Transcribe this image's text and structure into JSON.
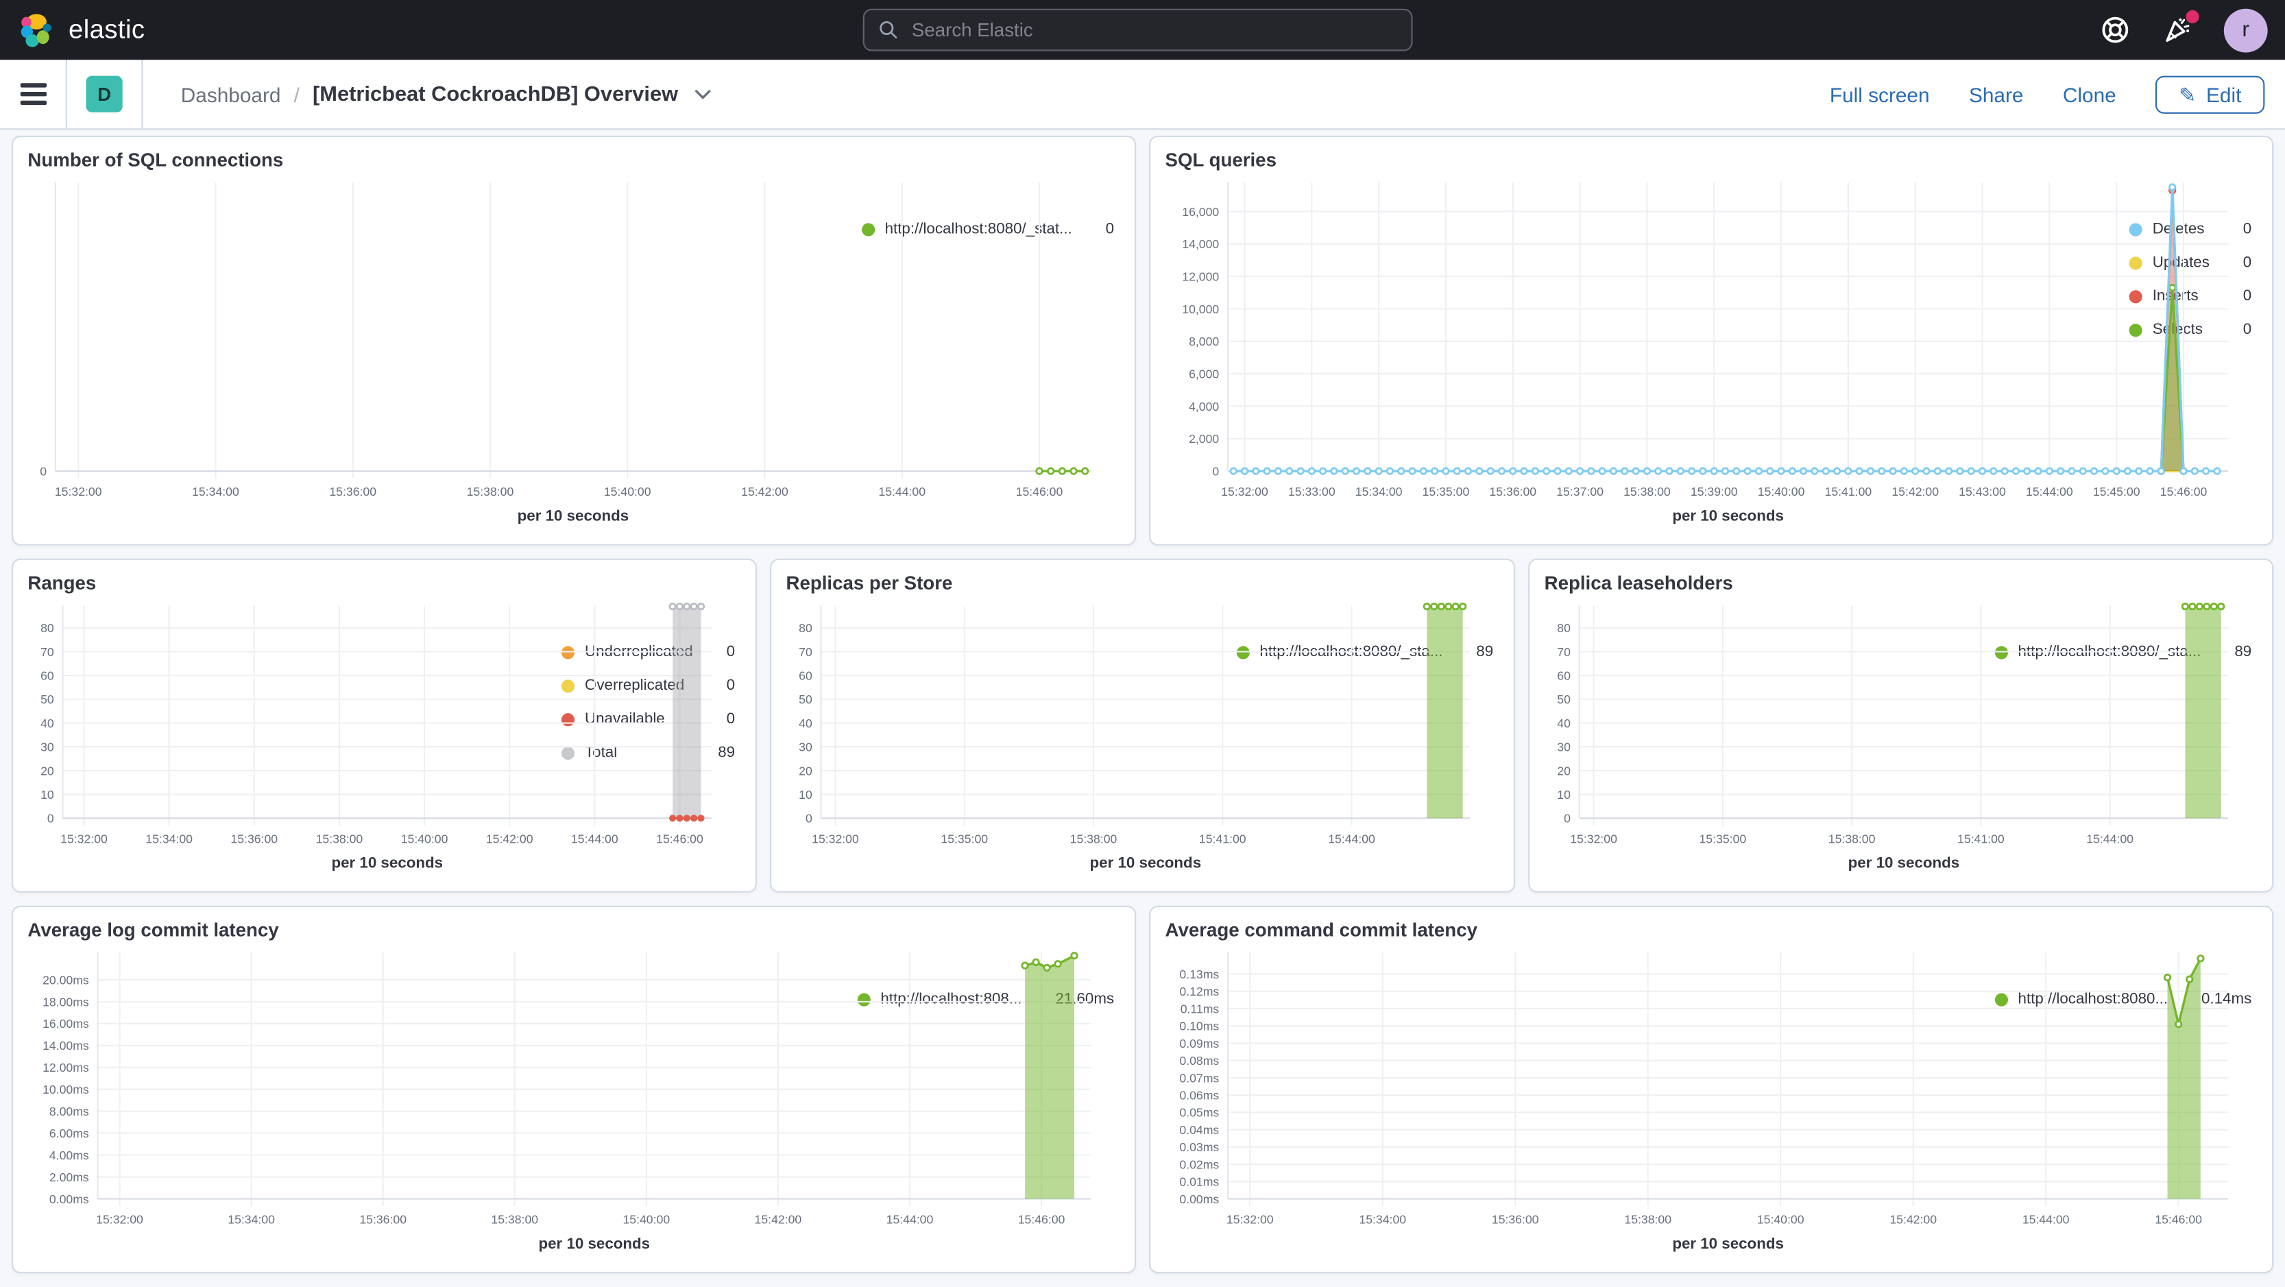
{
  "header": {
    "brand": "elastic",
    "search_placeholder": "Search Elastic",
    "avatar_initial": "r",
    "icons": [
      "help-icon",
      "news-icon",
      "avatar"
    ]
  },
  "toolbar": {
    "app_badge": "D",
    "breadcrumb_root": "Dashboard",
    "breadcrumb_sep": "/",
    "title": "[Metricbeat CockroachDB] Overview",
    "actions": {
      "full_screen": "Full screen",
      "share": "Share",
      "clone": "Clone",
      "edit": "Edit"
    }
  },
  "colors": {
    "topnav_bg": "#1d1e24",
    "accent_blue": "#2a6cb3",
    "badge_teal": "#3ebeb0",
    "notification_pink": "#dd2d66",
    "series_green": "#74b62b",
    "series_blue": "#7ecbf2",
    "series_yellow": "#efd24a",
    "series_red": "#e05c4f",
    "series_orange": "#f0a03a",
    "series_gray": "#9a9ba1",
    "grid_line": "#eef0f3",
    "axis_text": "#69707d"
  },
  "panels": [
    {
      "id": "sql-connections",
      "title": "Number of SQL connections",
      "legend": [
        {
          "label": "http://localhost:8080/_stat...",
          "value": "0",
          "color": "#74b62b"
        }
      ],
      "chart_data": {
        "type": "line",
        "xlabel": "per 10 seconds",
        "x_domain": [
          "15:31:40",
          "15:46:45"
        ],
        "x_ticks": [
          "15:32:00",
          "15:34:00",
          "15:36:00",
          "15:38:00",
          "15:40:00",
          "15:42:00",
          "15:44:00",
          "15:46:00"
        ],
        "y_tick_values": [
          0
        ],
        "y_tick_labels": [
          "0"
        ],
        "ylim": [
          0,
          8
        ],
        "series": [
          {
            "name": "http://localhost:8080/_stat...",
            "color": "#74b62b",
            "type": "line",
            "marker": "hollow",
            "data": [
              {
                "span": [
                  "15:46:00",
                  "15:46:40",
                  10,
                  0
                ]
              }
            ]
          }
        ]
      }
    },
    {
      "id": "sql-queries",
      "title": "SQL queries",
      "legend": [
        {
          "label": "Deletes",
          "value": "0",
          "color": "#7ecbf2"
        },
        {
          "label": "Updates",
          "value": "0",
          "color": "#efd24a"
        },
        {
          "label": "Inserts",
          "value": "0",
          "color": "#e05c4f"
        },
        {
          "label": "Selects",
          "value": "0",
          "color": "#74b62b"
        }
      ],
      "chart_data": {
        "type": "line",
        "xlabel": "per 10 seconds",
        "x_domain": [
          "15:31:45",
          "15:46:40"
        ],
        "x_ticks": [
          "15:32:00",
          "15:33:00",
          "15:34:00",
          "15:35:00",
          "15:36:00",
          "15:37:00",
          "15:38:00",
          "15:39:00",
          "15:40:00",
          "15:41:00",
          "15:42:00",
          "15:43:00",
          "15:44:00",
          "15:45:00",
          "15:46:00"
        ],
        "y_tick_values": [
          0,
          2000,
          4000,
          6000,
          8000,
          10000,
          12000,
          14000,
          16000
        ],
        "y_tick_labels": [
          "0",
          "2,000",
          "4,000",
          "6,000",
          "8,000",
          "10,000",
          "12,000",
          "14,000",
          "16,000"
        ],
        "ylim": [
          0,
          17800
        ],
        "series": [
          {
            "name": "Updates",
            "color": "#efd24a",
            "type": "line",
            "marker": "none",
            "data": [
              {
                "t": "15:45:40",
                "v": 0
              },
              {
                "t": "15:45:50",
                "v": 0
              },
              {
                "t": "15:46:00",
                "v": 0
              }
            ]
          },
          {
            "name": "Inserts",
            "color": "#e05c4f",
            "type": "area",
            "fill_opacity": 0.45,
            "marker": "hollow",
            "data": [
              {
                "t": "15:45:40",
                "v": 0
              },
              {
                "t": "15:45:50",
                "v": 17300
              },
              {
                "t": "15:46:00",
                "v": 0
              }
            ]
          },
          {
            "name": "Selects",
            "color": "#74b62b",
            "type": "area",
            "fill_opacity": 0.5,
            "marker": "hollow",
            "data": [
              {
                "t": "15:45:40",
                "v": 0
              },
              {
                "t": "15:45:50",
                "v": 11300
              },
              {
                "t": "15:46:00",
                "v": 0
              }
            ]
          },
          {
            "name": "Deletes",
            "color": "#7ecbf2",
            "type": "line",
            "marker": "hollow",
            "data": [
              {
                "span": [
                  "15:31:50",
                  "15:45:40",
                  10,
                  0
                ]
              },
              {
                "t": "15:45:50",
                "v": 17500
              },
              {
                "span": [
                  "15:46:00",
                  "15:46:30",
                  10,
                  0
                ]
              }
            ]
          }
        ]
      }
    },
    {
      "id": "ranges",
      "title": "Ranges",
      "legend": [
        {
          "label": "Underreplicated",
          "value": "0",
          "color": "#f0a03a"
        },
        {
          "label": "Overreplicated",
          "value": "0",
          "color": "#efd24a"
        },
        {
          "label": "Unavailable",
          "value": "0",
          "color": "#e05c4f"
        },
        {
          "label": "Total",
          "value": "89",
          "color": "#c8c9cd"
        }
      ],
      "chart_data": {
        "type": "area",
        "xlabel": "per 10 seconds",
        "x_domain": [
          "15:31:30",
          "15:46:45"
        ],
        "x_ticks": [
          "15:32:00",
          "15:34:00",
          "15:36:00",
          "15:38:00",
          "15:40:00",
          "15:42:00",
          "15:44:00",
          "15:46:00"
        ],
        "y_tick_values": [
          0,
          10,
          20,
          30,
          40,
          50,
          60,
          70,
          80
        ],
        "y_tick_labels": [
          "0",
          "10",
          "20",
          "30",
          "40",
          "50",
          "60",
          "70",
          "80"
        ],
        "ylim": [
          0,
          89.5
        ],
        "series": [
          {
            "name": "Total",
            "color": "#9a9ba1",
            "type": "area",
            "fill_opacity": 0.4,
            "stroke_color": "#c4c5ca",
            "marker": "hollow",
            "marker_color": "#b9bcc3",
            "data": [
              {
                "span": [
                  "15:45:50",
                  "15:46:30",
                  10,
                  89
                ]
              }
            ]
          },
          {
            "name": "Underreplicated",
            "color": "#f0a03a",
            "type": "line",
            "marker": "none",
            "data": [
              {
                "span": [
                  "15:45:50",
                  "15:46:30",
                  10,
                  0
                ]
              }
            ]
          },
          {
            "name": "Overreplicated",
            "color": "#efd24a",
            "type": "line",
            "marker": "none",
            "data": [
              {
                "span": [
                  "15:45:50",
                  "15:46:30",
                  10,
                  0
                ]
              }
            ]
          },
          {
            "name": "Unavailable",
            "color": "#e05c4f",
            "type": "line",
            "marker": "solid",
            "data": [
              {
                "span": [
                  "15:45:50",
                  "15:46:30",
                  10,
                  0
                ]
              }
            ]
          }
        ]
      }
    },
    {
      "id": "replicas-per-store",
      "title": "Replicas per Store",
      "legend": [
        {
          "label": "http://localhost:8080/_sta...",
          "value": "89",
          "color": "#74b62b"
        }
      ],
      "chart_data": {
        "type": "area",
        "xlabel": "per 10 seconds",
        "x_domain": [
          "15:31:40",
          "15:46:45"
        ],
        "x_ticks": [
          "15:32:00",
          "15:35:00",
          "15:38:00",
          "15:41:00",
          "15:44:00"
        ],
        "y_tick_values": [
          0,
          10,
          20,
          30,
          40,
          50,
          60,
          70,
          80
        ],
        "y_tick_labels": [
          "0",
          "10",
          "20",
          "30",
          "40",
          "50",
          "60",
          "70",
          "80"
        ],
        "ylim": [
          0,
          89.5
        ],
        "series": [
          {
            "name": "http://localhost:8080/_sta...",
            "color": "#74b62b",
            "type": "area",
            "fill_opacity": 0.5,
            "marker": "hollow",
            "data": [
              {
                "span": [
                  "15:45:45",
                  "15:46:35",
                  10,
                  89
                ]
              }
            ]
          }
        ]
      }
    },
    {
      "id": "replica-leaseholders",
      "title": "Replica leaseholders",
      "legend": [
        {
          "label": "http://localhost:8080/_sta...",
          "value": "89",
          "color": "#74b62b"
        }
      ],
      "chart_data": {
        "type": "area",
        "xlabel": "per 10 seconds",
        "x_domain": [
          "15:31:40",
          "15:46:45"
        ],
        "x_ticks": [
          "15:32:00",
          "15:35:00",
          "15:38:00",
          "15:41:00",
          "15:44:00"
        ],
        "y_tick_values": [
          0,
          10,
          20,
          30,
          40,
          50,
          60,
          70,
          80
        ],
        "y_tick_labels": [
          "0",
          "10",
          "20",
          "30",
          "40",
          "50",
          "60",
          "70",
          "80"
        ],
        "ylim": [
          0,
          89.5
        ],
        "series": [
          {
            "name": "http://localhost:8080/_sta...",
            "color": "#74b62b",
            "type": "area",
            "fill_opacity": 0.5,
            "marker": "hollow",
            "data": [
              {
                "span": [
                  "15:45:45",
                  "15:46:35",
                  10,
                  89
                ]
              }
            ]
          }
        ]
      }
    },
    {
      "id": "avg-log-commit-latency",
      "title": "Average log commit latency",
      "legend": [
        {
          "label": "http://localhost:808...",
          "value": "21.60ms",
          "color": "#74b62b"
        }
      ],
      "chart_data": {
        "type": "area",
        "xlabel": "per 10 seconds",
        "x_domain": [
          "15:31:40",
          "15:46:45"
        ],
        "x_ticks": [
          "15:32:00",
          "15:34:00",
          "15:36:00",
          "15:38:00",
          "15:40:00",
          "15:42:00",
          "15:44:00",
          "15:46:00"
        ],
        "y_tick_values": [
          0,
          2,
          4,
          6,
          8,
          10,
          12,
          14,
          16,
          18,
          20
        ],
        "y_tick_labels": [
          "0.00ms",
          "2.00ms",
          "4.00ms",
          "6.00ms",
          "8.00ms",
          "10.00ms",
          "12.00ms",
          "14.00ms",
          "16.00ms",
          "18.00ms",
          "20.00ms"
        ],
        "ylim": [
          0,
          22.5
        ],
        "series": [
          {
            "name": "http://localhost:808...",
            "color": "#74b62b",
            "type": "area",
            "fill_opacity": 0.5,
            "marker": "hollow",
            "data": [
              {
                "t": "15:45:45",
                "v": 21.3
              },
              {
                "t": "15:45:55",
                "v": 21.6
              },
              {
                "t": "15:46:05",
                "v": 21.1
              },
              {
                "t": "15:46:15",
                "v": 21.45
              },
              {
                "t": "15:46:30",
                "v": 22.2
              }
            ]
          }
        ]
      }
    },
    {
      "id": "avg-command-commit-latency",
      "title": "Average command commit latency",
      "legend": [
        {
          "label": "http://localhost:8080...",
          "value": "0.14ms",
          "color": "#74b62b"
        }
      ],
      "chart_data": {
        "type": "area",
        "xlabel": "per 10 seconds",
        "x_domain": [
          "15:31:40",
          "15:46:45"
        ],
        "x_ticks": [
          "15:32:00",
          "15:34:00",
          "15:36:00",
          "15:38:00",
          "15:40:00",
          "15:42:00",
          "15:44:00",
          "15:46:00"
        ],
        "y_tick_values": [
          0,
          0.01,
          0.02,
          0.03,
          0.04,
          0.05,
          0.06,
          0.07,
          0.08,
          0.09,
          0.1,
          0.11,
          0.12,
          0.13
        ],
        "y_tick_labels": [
          "0.00ms",
          "0.01ms",
          "0.02ms",
          "0.03ms",
          "0.04ms",
          "0.05ms",
          "0.06ms",
          "0.07ms",
          "0.08ms",
          "0.09ms",
          "0.10ms",
          "0.11ms",
          "0.12ms",
          "0.13ms"
        ],
        "ylim": [
          0,
          0.1425
        ],
        "series": [
          {
            "name": "http://localhost:8080...",
            "color": "#74b62b",
            "type": "area",
            "fill_opacity": 0.5,
            "marker": "hollow",
            "data": [
              {
                "t": "15:45:50",
                "v": 0.128
              },
              {
                "t": "15:46:00",
                "v": 0.101
              },
              {
                "t": "15:46:10",
                "v": 0.127
              },
              {
                "t": "15:46:20",
                "v": 0.139
              }
            ]
          }
        ]
      }
    }
  ]
}
